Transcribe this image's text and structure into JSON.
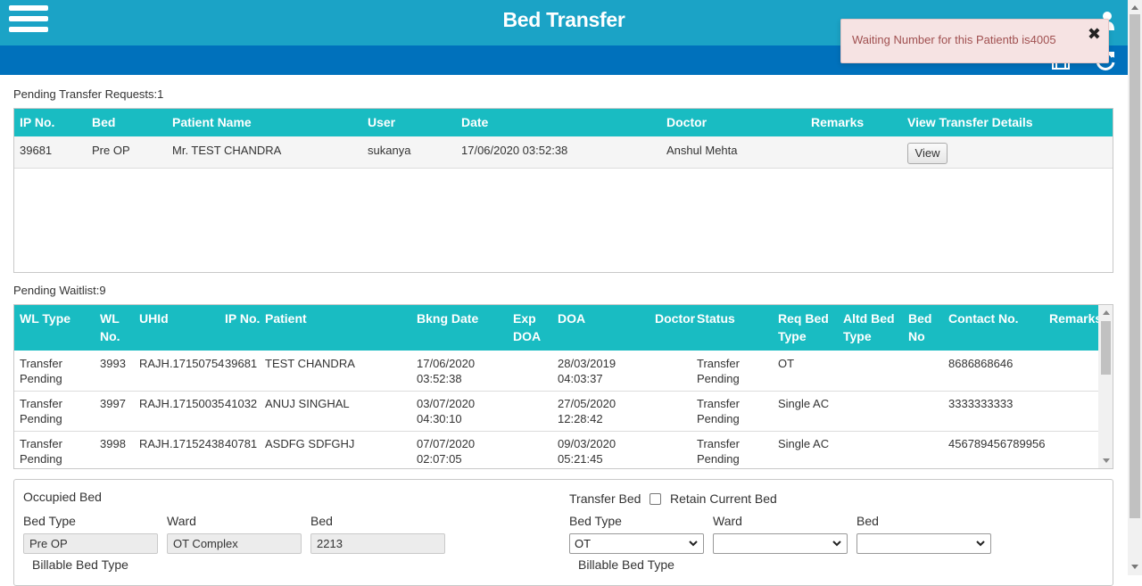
{
  "header": {
    "title": "Bed Transfer"
  },
  "toast": {
    "message": "Waiting Number for this Patientb is4005",
    "close": "✖"
  },
  "pending_requests": {
    "label": "Pending Transfer Requests:1",
    "columns": [
      "IP No.",
      "Bed",
      "Patient Name",
      "User",
      "Date",
      "Doctor",
      "Remarks",
      "View Transfer Details"
    ],
    "rows": [
      {
        "ip": "39681",
        "bed": "Pre OP",
        "patient": "Mr. TEST CHANDRA",
        "user": "sukanya",
        "date": "17/06/2020 03:52:38",
        "doctor": "Anshul Mehta",
        "remarks": "",
        "view": "View"
      }
    ]
  },
  "waitlist": {
    "label": "Pending Waitlist:9",
    "columns": {
      "wl_type": "WL Type",
      "wl_no_1": "WL",
      "wl_no_2": "No.",
      "uhid": "UHId",
      "ip": "IP No.",
      "patient": "Patient",
      "bkng": "Bkng Date",
      "exp_1": "Exp",
      "exp_2": "DOA",
      "doa": "DOA",
      "doctor": "Doctor",
      "status": "Status",
      "req_1": "Req Bed",
      "req_2": "Type",
      "altd_1": "Altd Bed",
      "altd_2": "Type",
      "bedno_1": "Bed",
      "bedno_2": "No",
      "contact": "Contact No.",
      "remarks": "Remarks"
    },
    "rows": [
      {
        "type1": "Transfer",
        "type2": "Pending",
        "wl": "3993",
        "uhid": "RAJH.17150754",
        "ip": "39681",
        "patient": "TEST CHANDRA",
        "bk1": "17/06/2020",
        "bk2": "03:52:38",
        "doa1": "28/03/2019",
        "doa2": "04:03:37",
        "st1": "Transfer",
        "st2": "Pending",
        "req": "OT",
        "contact": "8686868646"
      },
      {
        "type1": "Transfer",
        "type2": "Pending",
        "wl": "3997",
        "uhid": "RAJH.17150035",
        "ip": "41032",
        "patient": "ANUJ SINGHAL",
        "bk1": "03/07/2020",
        "bk2": "04:30:10",
        "doa1": "27/05/2020",
        "doa2": "12:28:42",
        "st1": "Transfer",
        "st2": "Pending",
        "req": "Single AC",
        "contact": "3333333333"
      },
      {
        "type1": "Transfer",
        "type2": "Pending",
        "wl": "3998",
        "uhid": "RAJH.17152438",
        "ip": "40781",
        "patient": "ASDFG SDFGHJ",
        "bk1": "07/07/2020",
        "bk2": "02:07:05",
        "doa1": "09/03/2020",
        "doa2": "05:21:45",
        "st1": "Transfer",
        "st2": "Pending",
        "req": "Single AC",
        "contact": "456789456789956"
      }
    ]
  },
  "occupied": {
    "title": "Occupied Bed",
    "bed_type_label": "Bed Type",
    "ward_label": "Ward",
    "bed_label": "Bed",
    "bed_type": "Pre OP",
    "ward": "OT Complex",
    "bed": "2213",
    "billable_label": "Billable Bed Type"
  },
  "transfer": {
    "title": "Transfer Bed",
    "retain_label": "Retain Current Bed",
    "bed_type_label": "Bed Type",
    "ward_label": "Ward",
    "bed_label": "Bed",
    "bed_type": "OT",
    "ward": "",
    "bed": "",
    "billable_label": "Billable Bed Type"
  },
  "colors": {
    "header": "#1ba3c6",
    "subbar": "#0071bc",
    "table_header": "#19bcc2"
  }
}
